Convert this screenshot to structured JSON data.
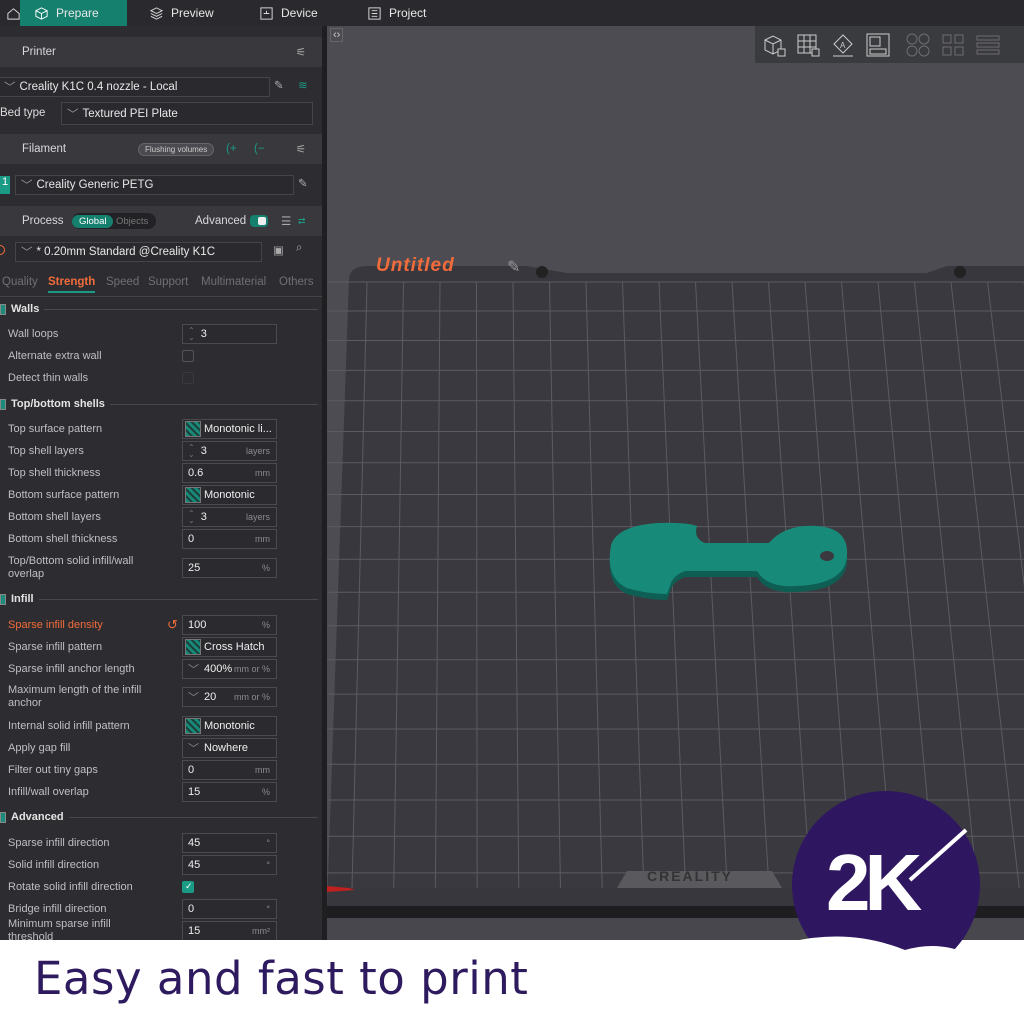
{
  "tabs": [
    {
      "label": "Prepare"
    },
    {
      "label": "Preview"
    },
    {
      "label": "Device"
    },
    {
      "label": "Project"
    }
  ],
  "printer": {
    "title": "Printer",
    "name": "Creality K1C 0.4 nozzle - Local",
    "bed_label": "Bed type",
    "bed_value": "Textured PEI Plate"
  },
  "filament": {
    "title": "Filament",
    "flushing": "Flushing volumes",
    "slot": "1",
    "name": "Creality Generic PETG"
  },
  "process": {
    "title": "Process",
    "global": "Global",
    "objects": "Objects",
    "advanced": "Advanced",
    "preset": "* 0.20mm Standard @Creality K1C"
  },
  "subtabs": [
    "Quality",
    "Strength",
    "Speed",
    "Support",
    "Multimaterial",
    "Others"
  ],
  "groups": {
    "walls": "Walls",
    "shells": "Top/bottom shells",
    "infill": "Infill",
    "advanced": "Advanced"
  },
  "rows": [
    {
      "label": "Wall loops",
      "value": "3",
      "spin": true
    },
    {
      "label": "Alternate extra wall",
      "check": false
    },
    {
      "label": "Detect thin walls",
      "check": false
    },
    {
      "label": "Top surface pattern",
      "value": "Monotonic li...",
      "pattern": true
    },
    {
      "label": "Top shell layers",
      "value": "3",
      "unit": "layers",
      "spin": true
    },
    {
      "label": "Top shell thickness",
      "value": "0.6",
      "unit": "mm"
    },
    {
      "label": "Bottom surface pattern",
      "value": "Monotonic",
      "pattern": true
    },
    {
      "label": "Bottom shell layers",
      "value": "3",
      "unit": "layers",
      "spin": true
    },
    {
      "label": "Bottom shell thickness",
      "value": "0",
      "unit": "mm"
    },
    {
      "label": "Top/Bottom solid infill/wall overlap",
      "value": "25",
      "unit": "%"
    },
    {
      "label": "Sparse infill density",
      "value": "100",
      "unit": "%",
      "modified": true
    },
    {
      "label": "Sparse infill pattern",
      "value": "Cross Hatch",
      "pattern": true
    },
    {
      "label": "Sparse infill anchor length",
      "value": "400%",
      "unit": "mm or %",
      "dropdown": true
    },
    {
      "label": "Maximum length of the infill anchor",
      "value": "20",
      "unit": "mm or %",
      "dropdown": true
    },
    {
      "label": "Internal solid infill pattern",
      "value": "Monotonic",
      "pattern": true
    },
    {
      "label": "Apply gap fill",
      "value": "Nowhere",
      "dropdown": true
    },
    {
      "label": "Filter out tiny gaps",
      "value": "0",
      "unit": "mm"
    },
    {
      "label": "Infill/wall overlap",
      "value": "15",
      "unit": "%"
    },
    {
      "label": "Sparse infill direction",
      "value": "45",
      "unit": "°"
    },
    {
      "label": "Solid infill direction",
      "value": "45",
      "unit": "°"
    },
    {
      "label": "Rotate solid infill direction",
      "check": true
    },
    {
      "label": "Bridge infill direction",
      "value": "0",
      "unit": "°"
    },
    {
      "label": "Minimum sparse infill threshold",
      "value": "15",
      "unit": "mm²"
    }
  ],
  "plate": {
    "name": "Untitled",
    "brand": "CREALITY"
  },
  "logo": {
    "text": "2K"
  },
  "tagline": "Easy and fast to print",
  "colors": {
    "accent": "#16806f",
    "modified": "#f26b3a",
    "brand_purple": "#2e1760"
  }
}
